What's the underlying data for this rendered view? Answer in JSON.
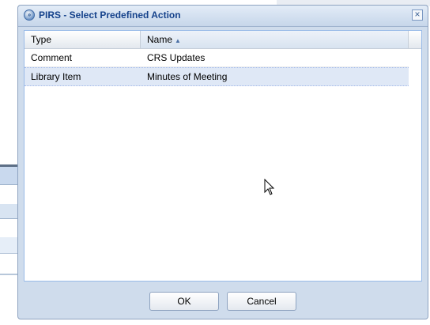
{
  "dialog": {
    "title": "PIRS - Select Predefined Action",
    "title_icon": "double-chevron-right-icon",
    "close_glyph": "×"
  },
  "grid": {
    "columns": [
      {
        "label": "Type"
      },
      {
        "label": "Name",
        "sort": "ascending",
        "sort_glyph": "▲"
      }
    ],
    "rows": [
      {
        "type": "Comment",
        "name": "CRS Updates",
        "selected": false
      },
      {
        "type": "Library Item",
        "name": "Minutes of Meeting",
        "selected": true
      }
    ]
  },
  "buttons": {
    "ok": "OK",
    "cancel": "Cancel"
  },
  "colors": {
    "title_text": "#15428b",
    "dialog_bg": "#cfdcec",
    "selected_row": "#dfe8f6"
  }
}
